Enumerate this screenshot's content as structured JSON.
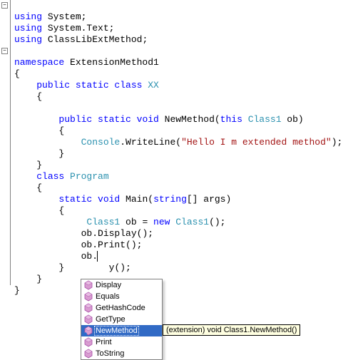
{
  "code": {
    "line1_using": "using",
    "line1_ns": " System;",
    "line2_using": "using",
    "line2_ns": " System.Text;",
    "line3_using": "using",
    "line3_ns": " ClassLibExtMethod;",
    "blank": "",
    "ns_kw": "namespace",
    "ns_name": " ExtensionMethod1",
    "lbrace": "{",
    "rbrace": "}",
    "indent4": "    ",
    "indent8": "        ",
    "indent12": "            ",
    "pub_static_class": "public static class ",
    "xx": "XX",
    "pub_static_void": "public static void ",
    "newmethod_name": "NewMethod(",
    "this_kw": "this",
    "class1_type": " Class1",
    "ob_param": " ob)",
    "console_type": "Console",
    "writeline": ".WriteLine(",
    "hello_str": "\"Hello I m extended method\"",
    "close_call": ");",
    "class_kw": "class ",
    "program": "Program",
    "static_void": "static void ",
    "main_sig1": "Main(",
    "string_kw": "string",
    "main_sig2": "[] args)",
    "class1_decl1": " ob = ",
    "new_kw": "new",
    "class1_ctor": "();",
    "ob_display": "ob.Display();",
    "ob_print": "ob.Print();",
    "ob_dot": "ob.",
    "hidden_tail": "y();"
  },
  "intellisense": {
    "items": [
      {
        "label": "Display",
        "kind": "method"
      },
      {
        "label": "Equals",
        "kind": "method"
      },
      {
        "label": "GetHashCode",
        "kind": "method"
      },
      {
        "label": "GetType",
        "kind": "method"
      },
      {
        "label": "NewMethod",
        "kind": "extension",
        "selected": true
      },
      {
        "label": "Print",
        "kind": "method"
      },
      {
        "label": "ToString",
        "kind": "method"
      }
    ]
  },
  "tooltip": "(extension) void Class1.NewMethod()"
}
